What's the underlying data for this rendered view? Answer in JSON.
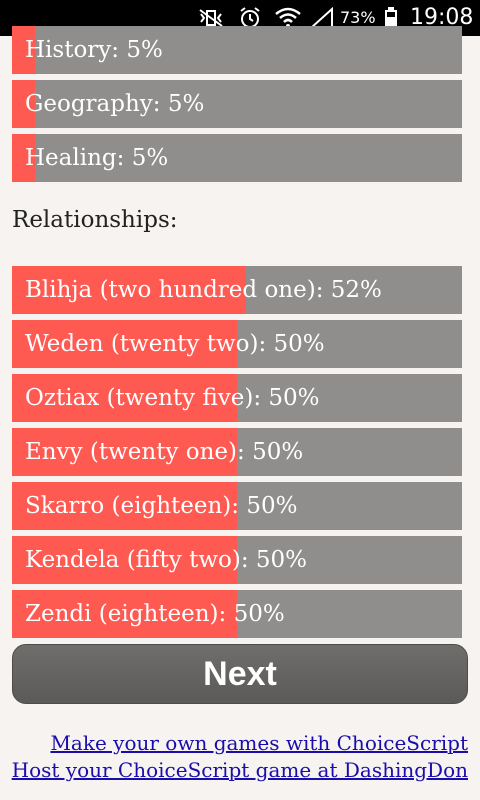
{
  "status_bar": {
    "icons": [
      "mute-vibrate-icon",
      "alarm-icon",
      "wifi-icon",
      "signal-icon",
      "battery-icon"
    ],
    "battery": "73%",
    "time": "19:08"
  },
  "skills": [
    {
      "label": "History: 5%",
      "value": 5
    },
    {
      "label": "Geography: 5%",
      "value": 5
    },
    {
      "label": "Healing: 5%",
      "value": 5
    }
  ],
  "relationships": {
    "title": "Relationships:",
    "items": [
      {
        "label": "Blihja (two hundred one): 52%",
        "value": 52
      },
      {
        "label": "Weden (twenty two): 50%",
        "value": 50
      },
      {
        "label": "Oztiax (twenty five): 50%",
        "value": 50
      },
      {
        "label": "Envy (twenty one): 50%",
        "value": 50
      },
      {
        "label": "Skarro (eighteen): 50%",
        "value": 50
      },
      {
        "label": "Kendela (fifty two): 50%",
        "value": 50
      },
      {
        "label": "Zendi (eighteen): 50%",
        "value": 50
      }
    ]
  },
  "next_button": "Next",
  "footer_links": [
    "Make your own games with ChoiceScript",
    "Host your ChoiceScript game at DashingDon"
  ],
  "colors": {
    "fill": "#ff5a52",
    "track": "#8f8e8c",
    "background": "#f6f3f0"
  }
}
